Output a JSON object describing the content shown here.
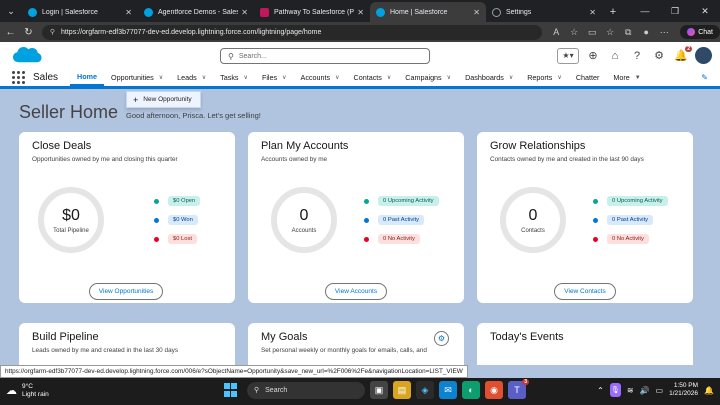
{
  "browser": {
    "tabs": [
      {
        "title": "Login | Salesforce",
        "color": "#00a1e0",
        "active": false
      },
      {
        "title": "Agentforce Demos - Salesforce",
        "color": "#00a1e0",
        "active": false
      },
      {
        "title": "Pathway To Salesforce (PTS) -",
        "color": "#c2185b",
        "active": false
      },
      {
        "title": "Home | Salesforce",
        "color": "#00a1e0",
        "active": true
      },
      {
        "title": "Settings",
        "color": "#9aa0a6",
        "active": false
      }
    ],
    "url": "https://orgfarm-edf3b77077-dev-ed.develop.lightning.force.com/lightning/page/home",
    "chat_label": "Chat"
  },
  "sf": {
    "search_placeholder": "Search...",
    "notification_count": "2",
    "app_name": "Sales",
    "nav": [
      {
        "label": "Home",
        "active": true,
        "dropdown": false
      },
      {
        "label": "Opportunities",
        "dropdown": true
      },
      {
        "label": "Leads",
        "dropdown": true
      },
      {
        "label": "Tasks",
        "dropdown": true
      },
      {
        "label": "Files",
        "dropdown": true
      },
      {
        "label": "Accounts",
        "dropdown": true
      },
      {
        "label": "Contacts",
        "dropdown": true
      },
      {
        "label": "Campaigns",
        "dropdown": true
      },
      {
        "label": "Dashboards",
        "dropdown": true
      },
      {
        "label": "Reports",
        "dropdown": true
      },
      {
        "label": "Chatter",
        "dropdown": false
      },
      {
        "label": "More",
        "dropdown": true
      }
    ],
    "dropdown_item": "New Opportunity"
  },
  "page": {
    "title": "Seller Home",
    "greeting": "Good afternoon, Prisca. Let's get selling!"
  },
  "cards": {
    "close_deals": {
      "title": "Close Deals",
      "desc": "Opportunities owned by me and closing this quarter",
      "value": "$0",
      "ring_label": "Total Pipeline",
      "stats": [
        "$0 Open",
        "$0 Won",
        "$0 Lost"
      ],
      "button": "View Opportunities"
    },
    "plan_accounts": {
      "title": "Plan My Accounts",
      "desc": "Accounts owned by me",
      "value": "0",
      "ring_label": "Accounts",
      "stats": [
        "0 Upcoming Activity",
        "0 Past Activity",
        "0 No Activity"
      ],
      "button": "View Accounts"
    },
    "grow_relationships": {
      "title": "Grow Relationships",
      "desc": "Contacts owned by me and created in the last 90 days",
      "value": "0",
      "ring_label": "Contacts",
      "stats": [
        "0 Upcoming Activity",
        "0 Past Activity",
        "0 No Activity"
      ],
      "button": "View Contacts"
    },
    "build_pipeline": {
      "title": "Build Pipeline",
      "desc": "Leads owned by me and created in the last 30 days"
    },
    "my_goals": {
      "title": "My Goals",
      "desc": "Set personal weekly or monthly goals for emails, calls, and"
    },
    "todays_events": {
      "title": "Today's Events"
    }
  },
  "status_url": "https://orgfarm-edf3b77077-dev-ed.develop.lightning.force.com/006/e?sObjectName=Opportunity&save_new_url=%2F006%2Fe&navigationLocation=LIST_VIEW",
  "taskbar": {
    "temp": "9°C",
    "weather": "Light rain",
    "search": "Search",
    "time": "1:50 PM",
    "date": "1/21/2026",
    "teams_badge": "3"
  },
  "colors": {
    "brand": "#0176d3",
    "page_bg": "#b0c4df",
    "teal": "#06a59a",
    "blue": "#0176d3",
    "red": "#ea001e"
  }
}
